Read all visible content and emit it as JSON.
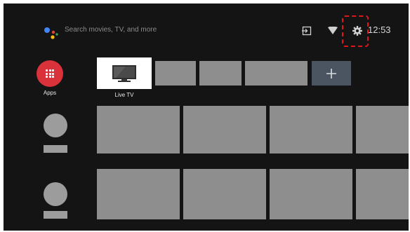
{
  "topbar": {
    "search_placeholder": "Search movies, TV, and more",
    "clock": "12:53",
    "icons": [
      "google-assistant-icon",
      "input-source-icon",
      "wifi-icon",
      "settings-gear-icon"
    ]
  },
  "apps": {
    "label": "Apps",
    "color": "#d9323a"
  },
  "favorites": {
    "live_tv_label": "Live TV",
    "add_label": "+"
  },
  "colors": {
    "background": "#141414",
    "tile": "#8e8e8e",
    "add_tile": "#4b5561",
    "highlight": "#e0161a"
  }
}
